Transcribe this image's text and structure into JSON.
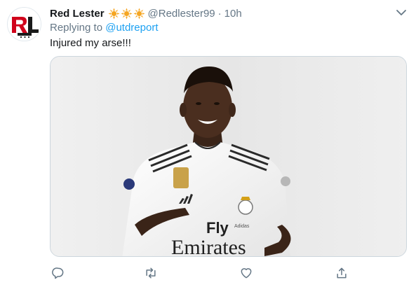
{
  "tweet": {
    "display_name": "Red Lester",
    "badges": [
      "sun-emoji-icon",
      "sun-emoji-icon",
      "sun-emoji-icon"
    ],
    "handle": "@Redlester99",
    "separator": "·",
    "time": "10h",
    "replying_prefix": "Replying to",
    "replying_to": "@utdreport",
    "text": "Injured my arse!!!",
    "avatar": {
      "letters": "RL",
      "caption": "Red Lester"
    },
    "media_text": {
      "sponsor_line1": "Fly",
      "sponsor_line2": "Emirates",
      "shirt_signature": "Adidas"
    }
  },
  "colors": {
    "text": "#14171a",
    "secondary": "#657786",
    "link": "#1da1f2",
    "border": "#ccd6dd",
    "star": "#f5a623",
    "avatar_red": "#d0021b"
  },
  "actions": [
    "reply-icon",
    "retweet-icon",
    "like-icon",
    "share-icon"
  ]
}
